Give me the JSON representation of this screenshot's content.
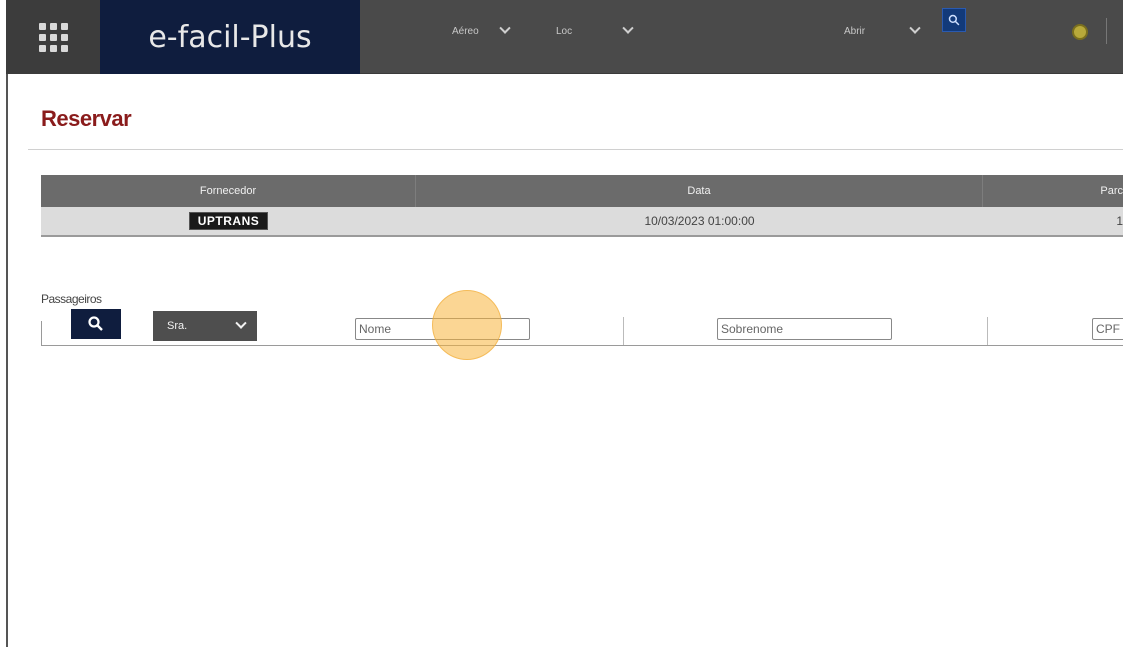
{
  "header": {
    "logo_text": "e-facil-Plus",
    "filter_1": "Aéreo",
    "filter_2": "Loc",
    "filter_3": "Abrir"
  },
  "page": {
    "title": "Reservar"
  },
  "table": {
    "columns": [
      "Fornecedor",
      "Data",
      "Parc"
    ],
    "rows": [
      {
        "fornecedor_logo": "UPTRANS",
        "data": "10/03/2023 01:00:00",
        "parc": "1"
      }
    ]
  },
  "passengers": {
    "label": "Passageiros",
    "title_select": "Sra.",
    "nome_placeholder": "Nome",
    "sobrenome_placeholder": "Sobrenome",
    "cpf_placeholder": "CPF"
  },
  "colors": {
    "topbar": "#4a4a4a",
    "logo_bg": "#0f1d3e",
    "title": "#8a1c1c",
    "table_header": "#6b6b6b",
    "row_bg": "#dcdcdc"
  }
}
